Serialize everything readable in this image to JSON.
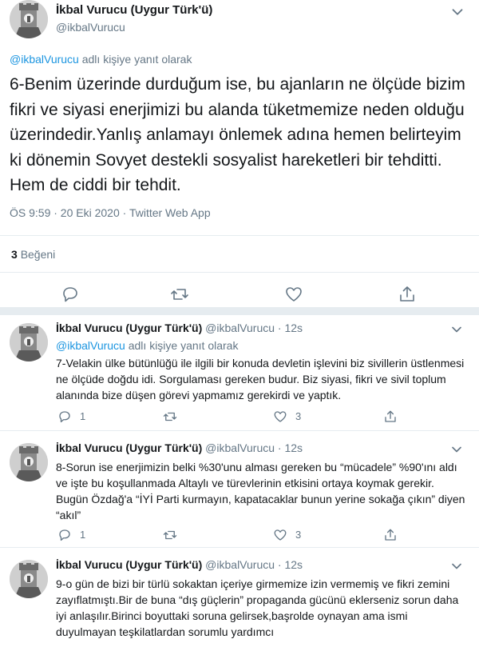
{
  "main_tweet": {
    "author_name": "İkbal Vurucu (Uygur Türk'ü)",
    "author_handle": "@ikbalVurucu",
    "reply_mention": "@ikbalVurucu",
    "reply_suffix": " adlı kişiye yanıt olarak",
    "text": "6-Benim üzerinde durduğum ise, bu ajanların ne ölçüde bizim fikri ve siyasi enerjimizi bu alanda tüketmemize neden olduğu üzerindedir.Yanlış anlamayı önlemek adına hemen belirteyim ki dönemin Sovyet destekli sosyalist hareketleri bir tehditti. Hem de ciddi bir tehdit.",
    "meta": "ÖS 9:59 · 20 Eki 2020 · Twitter Web App",
    "likes_count": "3",
    "likes_label": "Beğeni"
  },
  "replies": [
    {
      "author_name": "İkbal Vurucu (Uygur Türk'ü)",
      "author_handle": "@ikbalVurucu · 12s",
      "reply_mention": "@ikbalVurucu",
      "reply_suffix": " adlı kişiye yanıt olarak",
      "text": "7-Velakin ülke bütünlüğü ile ilgili bir konuda devletin işlevini biz sivillerin üstlenmesi ne ölçüde doğdu idi. Sorgulaması gereken budur. Biz siyasi, fikri ve sivil toplum alanında bize düşen görevi yapmamız gerekirdi ve yaptık.",
      "reply_count": "1",
      "like_count": "3"
    },
    {
      "author_name": "İkbal Vurucu (Uygur Türk'ü)",
      "author_handle": "@ikbalVurucu · 12s",
      "text": "8-Sorun ise enerjimizin belki %30'unu alması gereken bu “mücadele” %90'ını aldı ve işte bu koşullanmada Altaylı ve türevlerinin etkisini ortaya koymak gerekir. Bugün Özdağ'a “İYİ Parti kurmayın, kapatacaklar bunun yerine sokağa çıkın” diyen “akıl”",
      "reply_count": "1",
      "like_count": "3"
    },
    {
      "author_name": "İkbal Vurucu (Uygur Türk'ü)",
      "author_handle": "@ikbalVurucu · 12s",
      "text": "9-o gün de bizi bir türlü sokaktan içeriye girmemize izin vermemiş ve fikri zemini zayıflatmıştı.Bir de buna “dış güçlerin” propaganda gücünü eklerseniz sorun daha iyi anlaşılır.Birinci boyuttaki soruna gelirsek,başrolde oynayan ama ismi duyulmayan teşkilatlardan sorumlu yardımcı"
    }
  ],
  "colors": {
    "text": "#14171a",
    "secondary": "#657786",
    "link": "#1b95e0",
    "divider": "#e6ecf0"
  },
  "icons": [
    "avatar",
    "chevron-down-icon",
    "reply-icon",
    "retweet-icon",
    "like-icon",
    "share-icon"
  ]
}
